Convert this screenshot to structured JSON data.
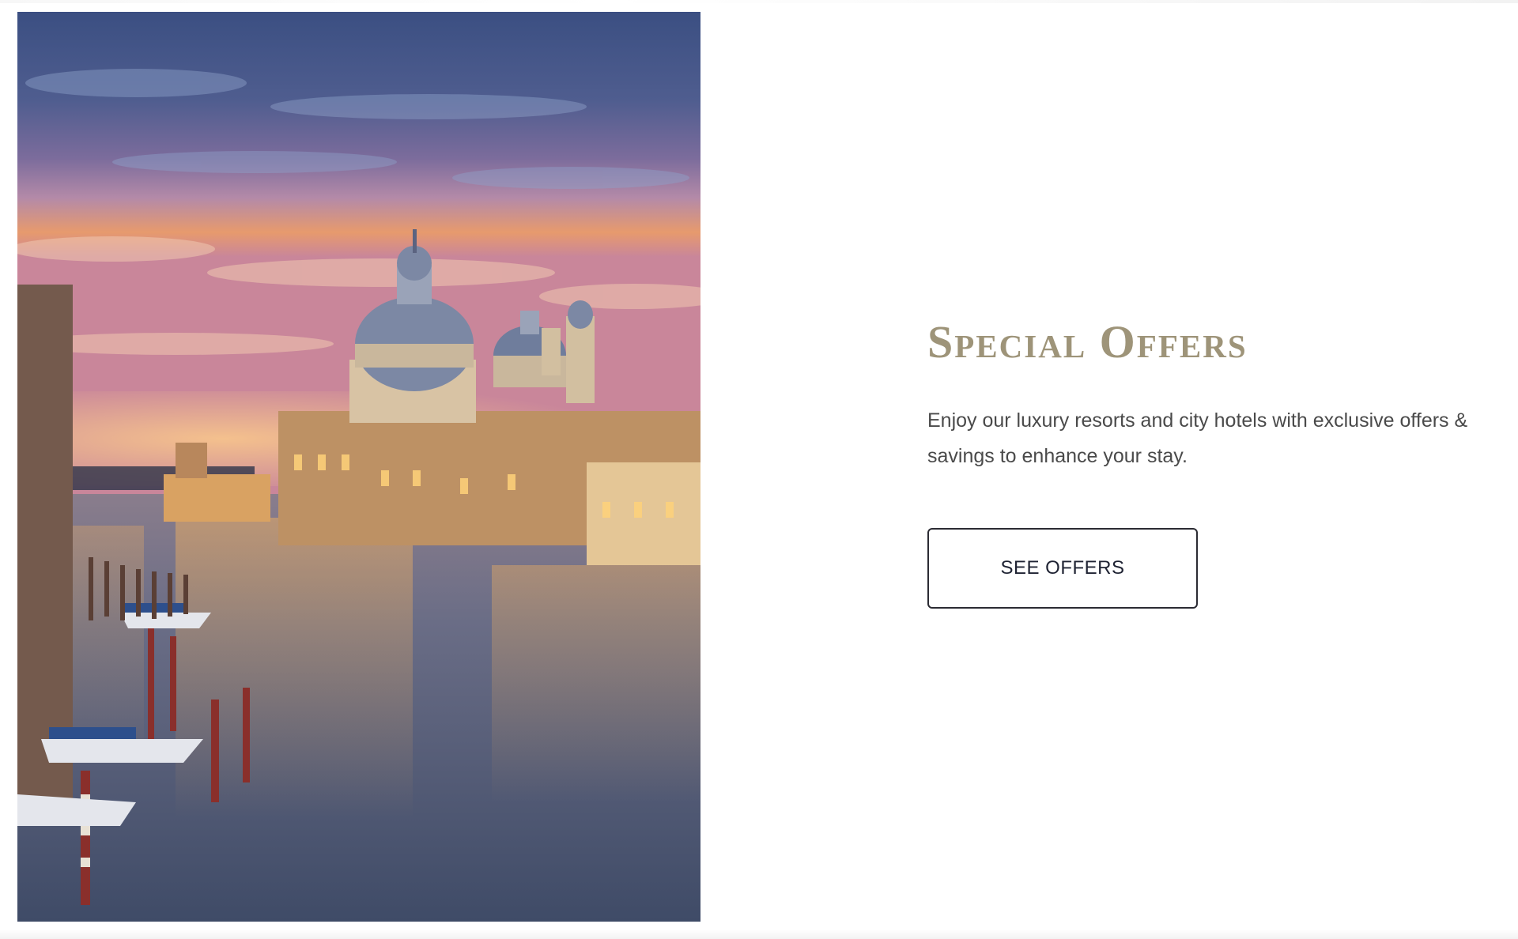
{
  "hero": {
    "image_subject": "Venice Grand Canal at dusk with the domed basilica",
    "colors": {
      "sky_top": "#3b4f82",
      "sky_mid": "#7c6c9c",
      "sky_glow": "#e79a6d",
      "water": "#53607d",
      "buildings": "#c79b6a",
      "domes": "#7c88a4"
    }
  },
  "offer": {
    "title": "Special Offers",
    "description": "Enjoy our luxury resorts and city hotels with exclusive offers & savings to enhance your stay.",
    "button_label": "SEE OFFERS"
  },
  "theme": {
    "title_color": "#9e9479",
    "text_color": "#4a4a4a",
    "button_border": "#2b2b33"
  }
}
